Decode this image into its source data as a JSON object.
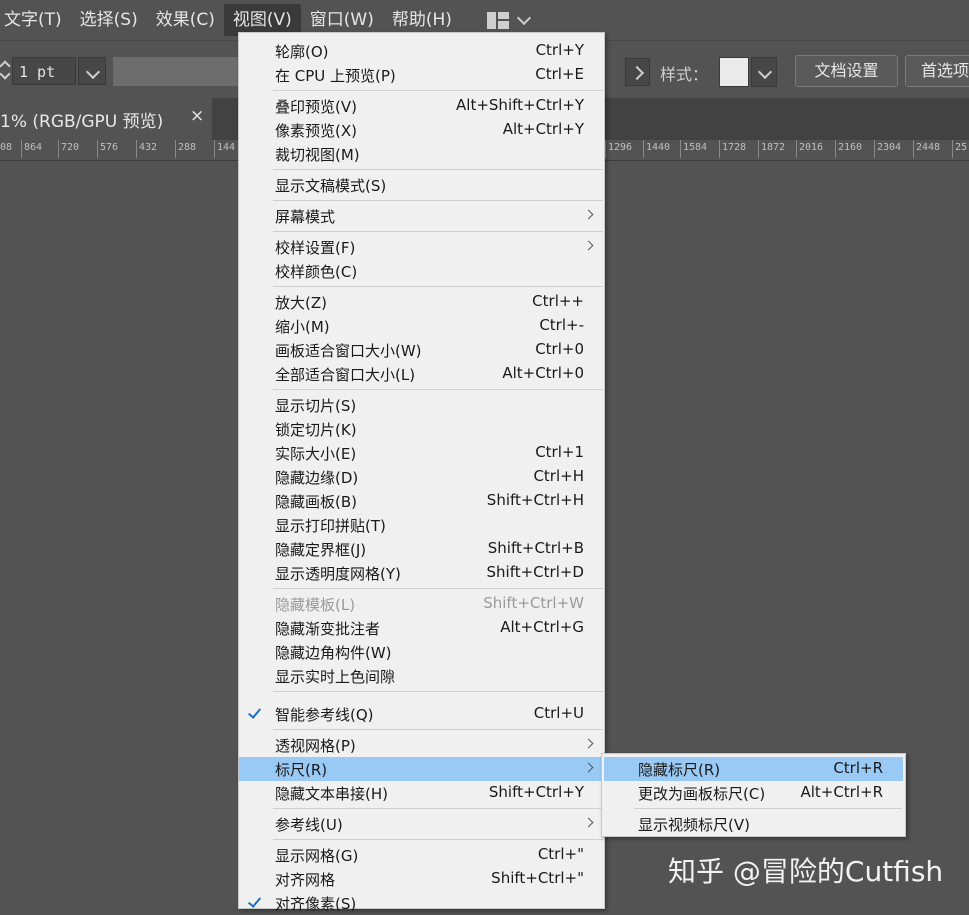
{
  "menubar": {
    "items": [
      "文字(T)",
      "选择(S)",
      "效果(C)",
      "视图(V)",
      "窗口(W)",
      "帮助(H)"
    ],
    "active_index": 3
  },
  "controlbar": {
    "stroke_value": "1 pt",
    "style_label": "样式：",
    "style_swatch_color": "#eaeaea",
    "doc_setup_label": "文档设置",
    "preferences_label": "首选项"
  },
  "tab": {
    "title": "1% (RGB/GPU 预览)",
    "close_glyph": "×"
  },
  "ruler": {
    "left_ticks": [
      "08",
      "864",
      "720",
      "576",
      "432",
      "288",
      "144"
    ],
    "right_ticks": [
      "1296",
      "1440",
      "1584",
      "1728",
      "1872",
      "2016",
      "2160",
      "2304",
      "2448",
      "25"
    ]
  },
  "view_menu": {
    "items": [
      {
        "label": "轮廓(O)",
        "shortcut": "Ctrl+Y"
      },
      {
        "label": "在 CPU 上预览(P)",
        "shortcut": "Ctrl+E"
      },
      {
        "label": "叠印预览(V)",
        "shortcut": "Alt+Shift+Ctrl+Y"
      },
      {
        "label": "像素预览(X)",
        "shortcut": "Alt+Ctrl+Y"
      },
      {
        "label": "裁切视图(M)",
        "shortcut": ""
      },
      {
        "label": "显示文稿模式(S)",
        "shortcut": ""
      },
      {
        "label": "屏幕模式",
        "shortcut": ""
      },
      {
        "label": "校样设置(F)",
        "shortcut": ""
      },
      {
        "label": "校样颜色(C)",
        "shortcut": ""
      },
      {
        "label": "放大(Z)",
        "shortcut": "Ctrl++"
      },
      {
        "label": "缩小(M)",
        "shortcut": "Ctrl+-"
      },
      {
        "label": "画板适合窗口大小(W)",
        "shortcut": "Ctrl+0"
      },
      {
        "label": "全部适合窗口大小(L)",
        "shortcut": "Alt+Ctrl+0"
      },
      {
        "label": "显示切片(S)",
        "shortcut": ""
      },
      {
        "label": "锁定切片(K)",
        "shortcut": ""
      },
      {
        "label": "实际大小(E)",
        "shortcut": "Ctrl+1"
      },
      {
        "label": "隐藏边缘(D)",
        "shortcut": "Ctrl+H"
      },
      {
        "label": "隐藏画板(B)",
        "shortcut": "Shift+Ctrl+H"
      },
      {
        "label": "显示打印拼贴(T)",
        "shortcut": ""
      },
      {
        "label": "隐藏定界框(J)",
        "shortcut": "Shift+Ctrl+B"
      },
      {
        "label": "显示透明度网格(Y)",
        "shortcut": "Shift+Ctrl+D"
      },
      {
        "label": "隐藏模板(L)",
        "shortcut": "Shift+Ctrl+W"
      },
      {
        "label": "隐藏渐变批注者",
        "shortcut": "Alt+Ctrl+G"
      },
      {
        "label": "隐藏边角构件(W)",
        "shortcut": ""
      },
      {
        "label": "显示实时上色间隙",
        "shortcut": ""
      },
      {
        "label": "智能参考线(Q)",
        "shortcut": "Ctrl+U"
      },
      {
        "label": "透视网格(P)",
        "shortcut": ""
      },
      {
        "label": "标尺(R)",
        "shortcut": ""
      },
      {
        "label": "隐藏文本串接(H)",
        "shortcut": "Shift+Ctrl+Y"
      },
      {
        "label": "参考线(U)",
        "shortcut": ""
      },
      {
        "label": "显示网格(G)",
        "shortcut": "Ctrl+\""
      },
      {
        "label": "对齐网格",
        "shortcut": "Shift+Ctrl+\""
      },
      {
        "label": "对齐像素(S)",
        "shortcut": ""
      }
    ]
  },
  "ruler_submenu": {
    "items": [
      {
        "label": "隐藏标尺(R)",
        "shortcut": "Ctrl+R"
      },
      {
        "label": "更改为画板标尺(C)",
        "shortcut": "Alt+Ctrl+R"
      },
      {
        "label": "显示视频标尺(V)",
        "shortcut": ""
      }
    ]
  },
  "watermark": "知乎 @冒险的Cutfish"
}
